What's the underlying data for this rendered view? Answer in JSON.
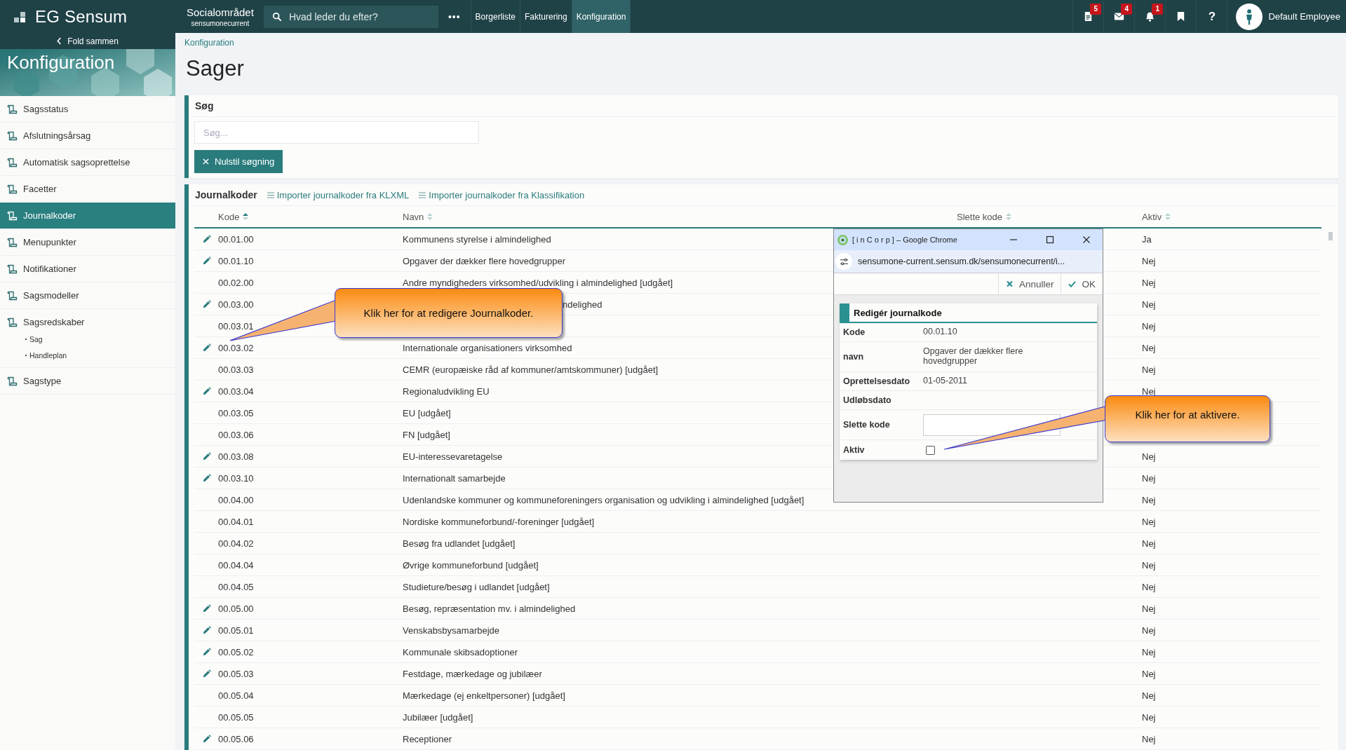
{
  "topbar": {
    "logo": "EG Sensum",
    "org": {
      "name": "Socialområdet",
      "sub": "sensumonecurrent"
    },
    "search": {
      "placeholder": "Hvad leder du efter?"
    },
    "more": "•••",
    "nav": [
      {
        "label": "Borgerliste",
        "selected": false
      },
      {
        "label": "Fakturering",
        "selected": false
      },
      {
        "label": "Konfiguration",
        "selected": true
      }
    ],
    "icons": [
      {
        "kind": "document",
        "badge": "5"
      },
      {
        "kind": "mail",
        "badge": "4"
      },
      {
        "kind": "bell",
        "badge": "1"
      },
      {
        "kind": "bookmark"
      },
      {
        "kind": "help",
        "label": "?"
      }
    ],
    "user": "Default Employee"
  },
  "sidebar": {
    "collapse": "Fold sammen",
    "banner": {
      "title": "Konfiguration",
      "kind": "picture"
    },
    "items": [
      {
        "label": "Sagsstatus",
        "selected": false
      },
      {
        "label": "Afslutningsårsag",
        "selected": false
      },
      {
        "label": "Automatisk sagsoprettelse",
        "selected": false
      },
      {
        "label": "Facetter",
        "selected": false
      },
      {
        "label": "Journalkoder",
        "selected": true
      },
      {
        "label": "Menupunkter",
        "selected": false
      },
      {
        "label": "Notifikationer",
        "selected": false
      },
      {
        "label": "Sagsmodeller",
        "selected": false
      },
      {
        "label": "Sagsredskaber",
        "selected": false,
        "children": [
          {
            "label": "Sag"
          },
          {
            "label": "Handleplan"
          }
        ]
      },
      {
        "label": "Sagstype",
        "selected": false
      }
    ]
  },
  "breadcrumb": "Konfiguration",
  "title": "Sager",
  "search_panel": {
    "title": "Søg",
    "field": {
      "placeholder": "Søg..."
    },
    "reset_button": "Nulstil søgning"
  },
  "table_panel": {
    "title": "Journalkoder",
    "actions": [
      "Importer journalkoder fra KLXML",
      "Importer journalkoder fra Klassifikation"
    ],
    "columns": [
      {
        "label": "Kode",
        "sorted": true
      },
      {
        "label": "Navn",
        "sorted": false
      },
      {
        "label": "Slette kode",
        "sorted": false
      },
      {
        "label": "Aktiv",
        "sorted": false
      }
    ],
    "rows": [
      {
        "editable": true,
        "kode": "00.01.00",
        "navn": "Kommunens styrelse i almindelighed",
        "aktiv": "Ja"
      },
      {
        "editable": true,
        "kode": "00.01.10",
        "navn": "Opgaver der dækker flere hovedgrupper",
        "aktiv": "Nej"
      },
      {
        "editable": false,
        "kode": "00.02.00",
        "navn": "Andre myndigheders virksomhed/udvikling i almindelighed [udgået]",
        "aktiv": "Nej"
      },
      {
        "editable": true,
        "kode": "00.03.00",
        "navn": "ndelighed",
        "clipped": true,
        "aktiv": "Nej"
      },
      {
        "editable": false,
        "kode": "00.03.01",
        "aktiv": "Nej"
      },
      {
        "editable": true,
        "kode": "00.03.02",
        "navn": "Internationale organisationers virksomhed",
        "aktiv": "Nej"
      },
      {
        "editable": false,
        "kode": "00.03.03",
        "navn": "CEMR (europæiske råd af kommuner/amtskommuner) [udgået]",
        "aktiv": "Nej"
      },
      {
        "editable": true,
        "kode": "00.03.04",
        "navn": "Regionaludvikling EU",
        "aktiv": "Nej"
      },
      {
        "editable": false,
        "kode": "00.03.05",
        "navn": "EU [udgået]"
      },
      {
        "editable": false,
        "kode": "00.03.06",
        "navn": "FN [udgået]"
      },
      {
        "editable": true,
        "kode": "00.03.08",
        "navn": "EU-interessevaretagelse",
        "aktiv": "Nej"
      },
      {
        "editable": true,
        "kode": "00.03.10",
        "navn": "Internationalt samarbejde",
        "aktiv": "Nej"
      },
      {
        "editable": false,
        "kode": "00.04.00",
        "navn": "Udenlandske kommuner og kommuneforeningers organisation og udvikling i almindelighed [udgået]",
        "aktiv": "Nej"
      },
      {
        "editable": false,
        "kode": "00.04.01",
        "navn": "Nordiske kommuneforbund/-foreninger [udgået]",
        "aktiv": "Nej"
      },
      {
        "editable": false,
        "kode": "00.04.02",
        "navn": "Besøg fra udlandet [udgået]",
        "aktiv": "Nej"
      },
      {
        "editable": false,
        "kode": "00.04.04",
        "navn": "Øvrige kommuneforbund [udgået]",
        "aktiv": "Nej"
      },
      {
        "editable": false,
        "kode": "00.04.05",
        "navn": "Studieture/besøg i udlandet [udgået]",
        "aktiv": "Nej"
      },
      {
        "editable": true,
        "kode": "00.05.00",
        "navn": "Besøg, repræsentation mv. i almindelighed",
        "aktiv": "Nej"
      },
      {
        "editable": true,
        "kode": "00.05.01",
        "navn": "Venskabsbysamarbejde",
        "aktiv": "Nej"
      },
      {
        "editable": true,
        "kode": "00.05.02",
        "navn": "Kommunale skibsadoptioner",
        "aktiv": "Nej"
      },
      {
        "editable": true,
        "kode": "00.05.03",
        "navn": "Festdage, mærkedage og jubilæer",
        "aktiv": "Nej"
      },
      {
        "editable": false,
        "kode": "00.05.04",
        "navn": "Mærkedage (ej enkeltpersoner) [udgået]",
        "aktiv": "Nej"
      },
      {
        "editable": false,
        "kode": "00.05.05",
        "navn": "Jubilæer [udgået]",
        "aktiv": "Nej"
      },
      {
        "editable": true,
        "kode": "00.05.06",
        "navn": "Receptioner",
        "aktiv": "Nej"
      }
    ]
  },
  "popup": {
    "title": "[ i n C o r p ] – Google Chrome",
    "url": "sensumone-current.sensum.dk/sensumonecurrent/i...",
    "buttons": [
      {
        "kind": "cancel",
        "label": "Annuller"
      },
      {
        "kind": "ok",
        "label": "OK"
      }
    ],
    "form_title": "Redigér journalkode",
    "fields": [
      {
        "kind": "text",
        "label": "Kode",
        "value": "00.01.10"
      },
      {
        "kind": "text",
        "label": "navn",
        "value": "Opgaver der dækker flere hovedgrupper"
      },
      {
        "kind": "text",
        "label": "Oprettelsesdato",
        "value": "01-05-2011"
      },
      {
        "kind": "text",
        "label": "Udløbsdato"
      },
      {
        "kind": "input",
        "label": "Slette kode"
      },
      {
        "kind": "checkbox",
        "label": "Aktiv",
        "checked": false
      }
    ]
  },
  "callouts": [
    {
      "text": "Klik her for at redigere Journalkoder."
    },
    {
      "text": "Klik her for at aktivere."
    }
  ]
}
